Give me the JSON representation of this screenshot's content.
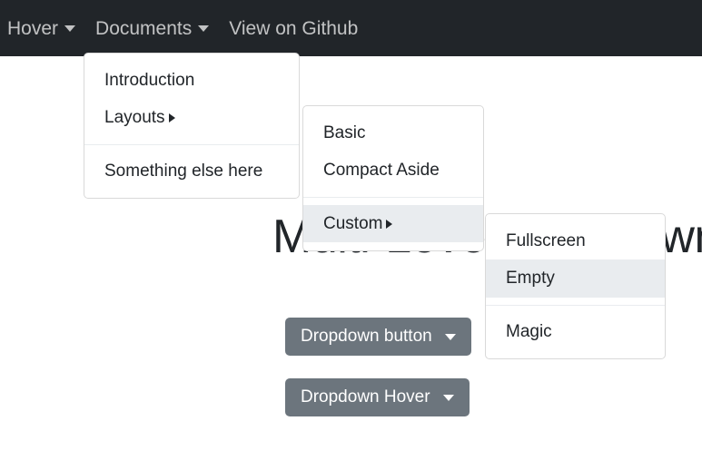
{
  "navbar": {
    "background_color": "#212529",
    "text_color": "#b8bcc0",
    "items": [
      {
        "label": "Hover",
        "has_caret": true,
        "icon": "caret-down-icon"
      },
      {
        "label": "Documents",
        "has_caret": true,
        "icon": "caret-down-icon"
      },
      {
        "label": "View on Github",
        "has_caret": false
      }
    ]
  },
  "main": {
    "heading": "Multi-Level Dropdown",
    "buttons": [
      {
        "label": "Dropdown button",
        "color": "#6c757d",
        "caret": "caret-down-icon"
      },
      {
        "label": "Dropdown Hover",
        "color": "#6c757d",
        "caret": "caret-down-icon"
      }
    ]
  },
  "menus": {
    "documents": {
      "items": [
        {
          "label": "Introduction",
          "submenu": false,
          "active": false
        },
        {
          "label": "Layouts",
          "submenu": true,
          "active": false
        },
        {
          "divider": true
        },
        {
          "label": "Something else here",
          "submenu": false,
          "active": false
        }
      ]
    },
    "layouts": {
      "items": [
        {
          "label": "Basic",
          "submenu": false,
          "active": false
        },
        {
          "label": "Compact Aside",
          "submenu": false,
          "active": false
        },
        {
          "divider": true
        },
        {
          "label": "Custom",
          "submenu": true,
          "active": true
        }
      ]
    },
    "custom": {
      "items": [
        {
          "label": "Fullscreen",
          "submenu": false,
          "active": false
        },
        {
          "label": "Empty",
          "submenu": false,
          "active": true
        },
        {
          "divider": true
        },
        {
          "label": "Magic",
          "submenu": false,
          "active": false
        }
      ]
    }
  },
  "colors": {
    "navbar_bg": "#212529",
    "menu_bg": "#ffffff",
    "menu_border": "#d8d9da",
    "menu_hover_bg": "#e9ecef",
    "button_bg": "#6c757d",
    "text": "#212529"
  }
}
